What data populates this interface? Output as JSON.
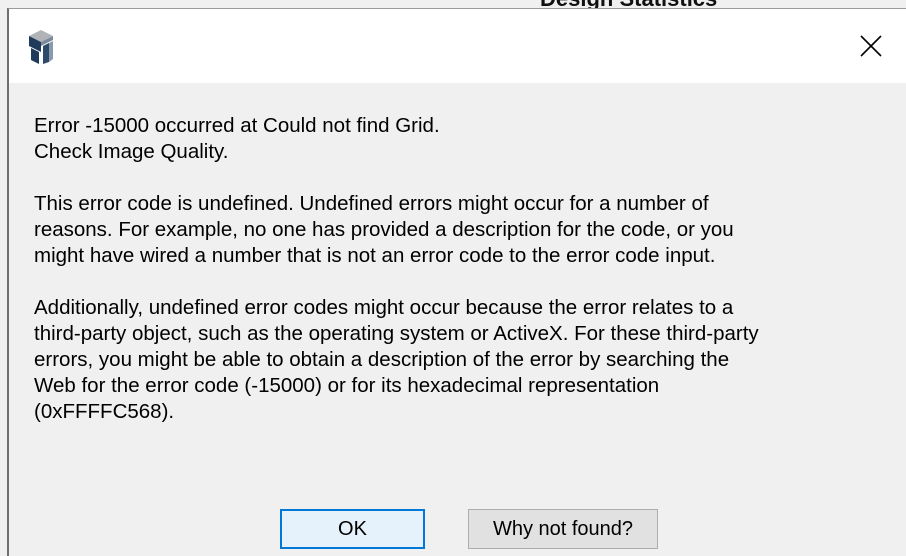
{
  "background": {
    "partial_text": "Design Statistics"
  },
  "dialog": {
    "icon": "app-logo-icon",
    "close_icon": "close-icon",
    "paragraphs": [
      "Error -15000 occurred at Could not find Grid.\nCheck Image Quality.",
      "This error code is undefined. Undefined errors might occur for a number of\nreasons. For example, no one has provided a description for the code, or you\nmight have wired a number that is not an error code to the error code input.",
      "Additionally, undefined error codes might occur because the error relates to a\nthird-party object, such as the operating system or ActiveX. For these third-party\nerrors, you might be able to obtain a description of the error by searching the\nWeb for the error code (-15000) or for its hexadecimal representation\n(0xFFFFC568)."
    ],
    "buttons": {
      "ok_label": "OK",
      "why_label": "Why not found?"
    }
  },
  "colors": {
    "titlebar": "#ffffff",
    "body": "#f0f0f0",
    "ok_border": "#0078d7",
    "button_face": "#e1e1e1"
  }
}
